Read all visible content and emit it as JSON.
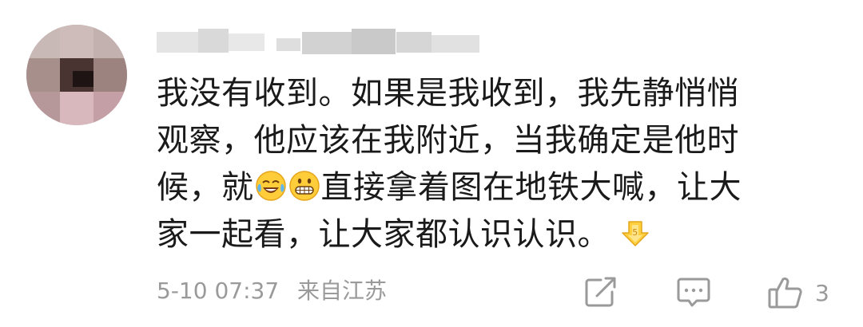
{
  "comment": {
    "author": {
      "name": "",
      "avatar": "avatar-image-mosaic"
    },
    "lines": [
      "我没有收到。如果是我收到，我先静悄悄",
      "观察，他应该在我附近，当我确定是他时",
      {
        "before": "候，就",
        "emojis": [
          "laughing-tears-emoji",
          "grinning-emoji"
        ],
        "after": "直接拿着图在地铁大喊，让大"
      },
      {
        "text": "家一起看，让大家都认识认识。",
        "emoji": "yellow-arrow-emoji"
      }
    ],
    "time": "5-10 07:37",
    "location": "来自江苏"
  },
  "actions": {
    "share_icon": "share-icon",
    "reply_icon": "reply-icon",
    "like_icon": "thumbs-up-icon",
    "like_count": "3"
  },
  "colors": {
    "text": "#1a1a1a",
    "meta": "#9a9a9a",
    "background": "#ffffff"
  }
}
